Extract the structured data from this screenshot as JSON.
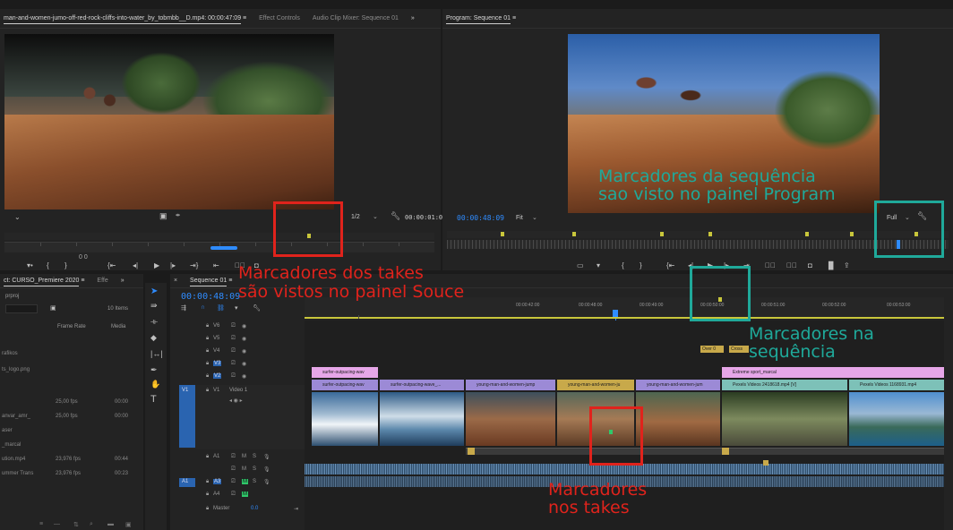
{
  "source": {
    "tabs": [
      "man-and-women-jumo-off-red-rock-cliffs-into-water_by_tobmbb__D.mp4: 00:00:47:09",
      "Effect Controls",
      "Audio Clip Mixer: Sequence 01"
    ],
    "menu_icon": "≡",
    "more_icon": "»",
    "resolution": "1/2",
    "timecode": "00:00:01:08",
    "playhead_label": "0 0"
  },
  "program": {
    "tab": "Program: Sequence 01",
    "menu_icon": "≡",
    "timecode": "00:00:48:09",
    "fit": "Fit",
    "resolution": "Full"
  },
  "project": {
    "tabs": [
      "ct: CURSO_Premiere 2020",
      "Effe"
    ],
    "file": "prproj",
    "items_count": "10 Items",
    "columns": [
      "Frame Rate",
      "Media"
    ],
    "rows": [
      {
        "name": "rafikos",
        "fps": "",
        "media": ""
      },
      {
        "name": "ts_logo.png",
        "fps": "",
        "media": ""
      },
      {
        "name": "",
        "fps": "25,00 fps",
        "media": "00:00"
      },
      {
        "name": "anvar_amr_",
        "fps": "25,00 fps",
        "media": "00:00"
      },
      {
        "name": "aser",
        "fps": "",
        "media": ""
      },
      {
        "name": "_marcal",
        "fps": "",
        "media": ""
      },
      {
        "name": "ution.mp4",
        "fps": "23,976 fps",
        "media": "00:44"
      },
      {
        "name": "ummer Trans",
        "fps": "23,976 fps",
        "media": "00:23"
      }
    ]
  },
  "timeline": {
    "tab": "Sequence 01",
    "menu_icon": "≡",
    "timecode": "00:00:48:09",
    "ruler_labels": [
      "00:00:42:00",
      "00:00:48:00",
      "00:00:49:00",
      "00:00:50:00",
      "00:00:51:00",
      "00:00:52:00",
      "00:00:53:00"
    ],
    "tracks": [
      {
        "name": "V6"
      },
      {
        "name": "V5"
      },
      {
        "name": "V4"
      },
      {
        "name": "V3"
      },
      {
        "name": "V2"
      },
      {
        "name": "V1",
        "label": "Video 1"
      },
      {
        "name": "A1"
      },
      {
        "name": "A2"
      },
      {
        "name": "A3"
      },
      {
        "name": "A4"
      }
    ],
    "master_label": "Master",
    "master_value": "0.0",
    "track_labels": {
      "left_v1": "V1",
      "left_a1": "A1"
    },
    "clips": {
      "v3_small": [
        "Over 0",
        "Cross"
      ],
      "v2": [
        "surfer-outpacing-wav",
        "Extreme sport_marcal"
      ],
      "v1": [
        "surfer-outpacing-wav",
        "surfer-outpacing-wave_...",
        "young-man-and-women-jump",
        "young-man-and-women-ju",
        "young-man-and-women-jum",
        "Pexels Videos 2418618.mp4 [V]",
        "Pexels Videos 1168931.mp4"
      ]
    }
  },
  "annotations": {
    "source_markers": [
      "Marcadores dos takes",
      "são vistos no painel Souce"
    ],
    "program_markers": [
      "Marcadores da sequência",
      "sao visto no painel Program"
    ],
    "sequence_markers": [
      "Marcadores na",
      "sequência"
    ],
    "take_markers": [
      "Marcadores",
      "nos takes"
    ]
  },
  "colors": {
    "accent_blue": "#2f8cff",
    "annotation_red": "#e0231c",
    "annotation_teal": "#1fa99a",
    "marker_yellow": "#c8c63b",
    "clip_pink": "#e6a6e8",
    "clip_purple": "#9c8ad6",
    "clip_teal": "#7dc1b8",
    "clip_gold": "#c8a94a",
    "audio_green": "#2fc86a"
  }
}
